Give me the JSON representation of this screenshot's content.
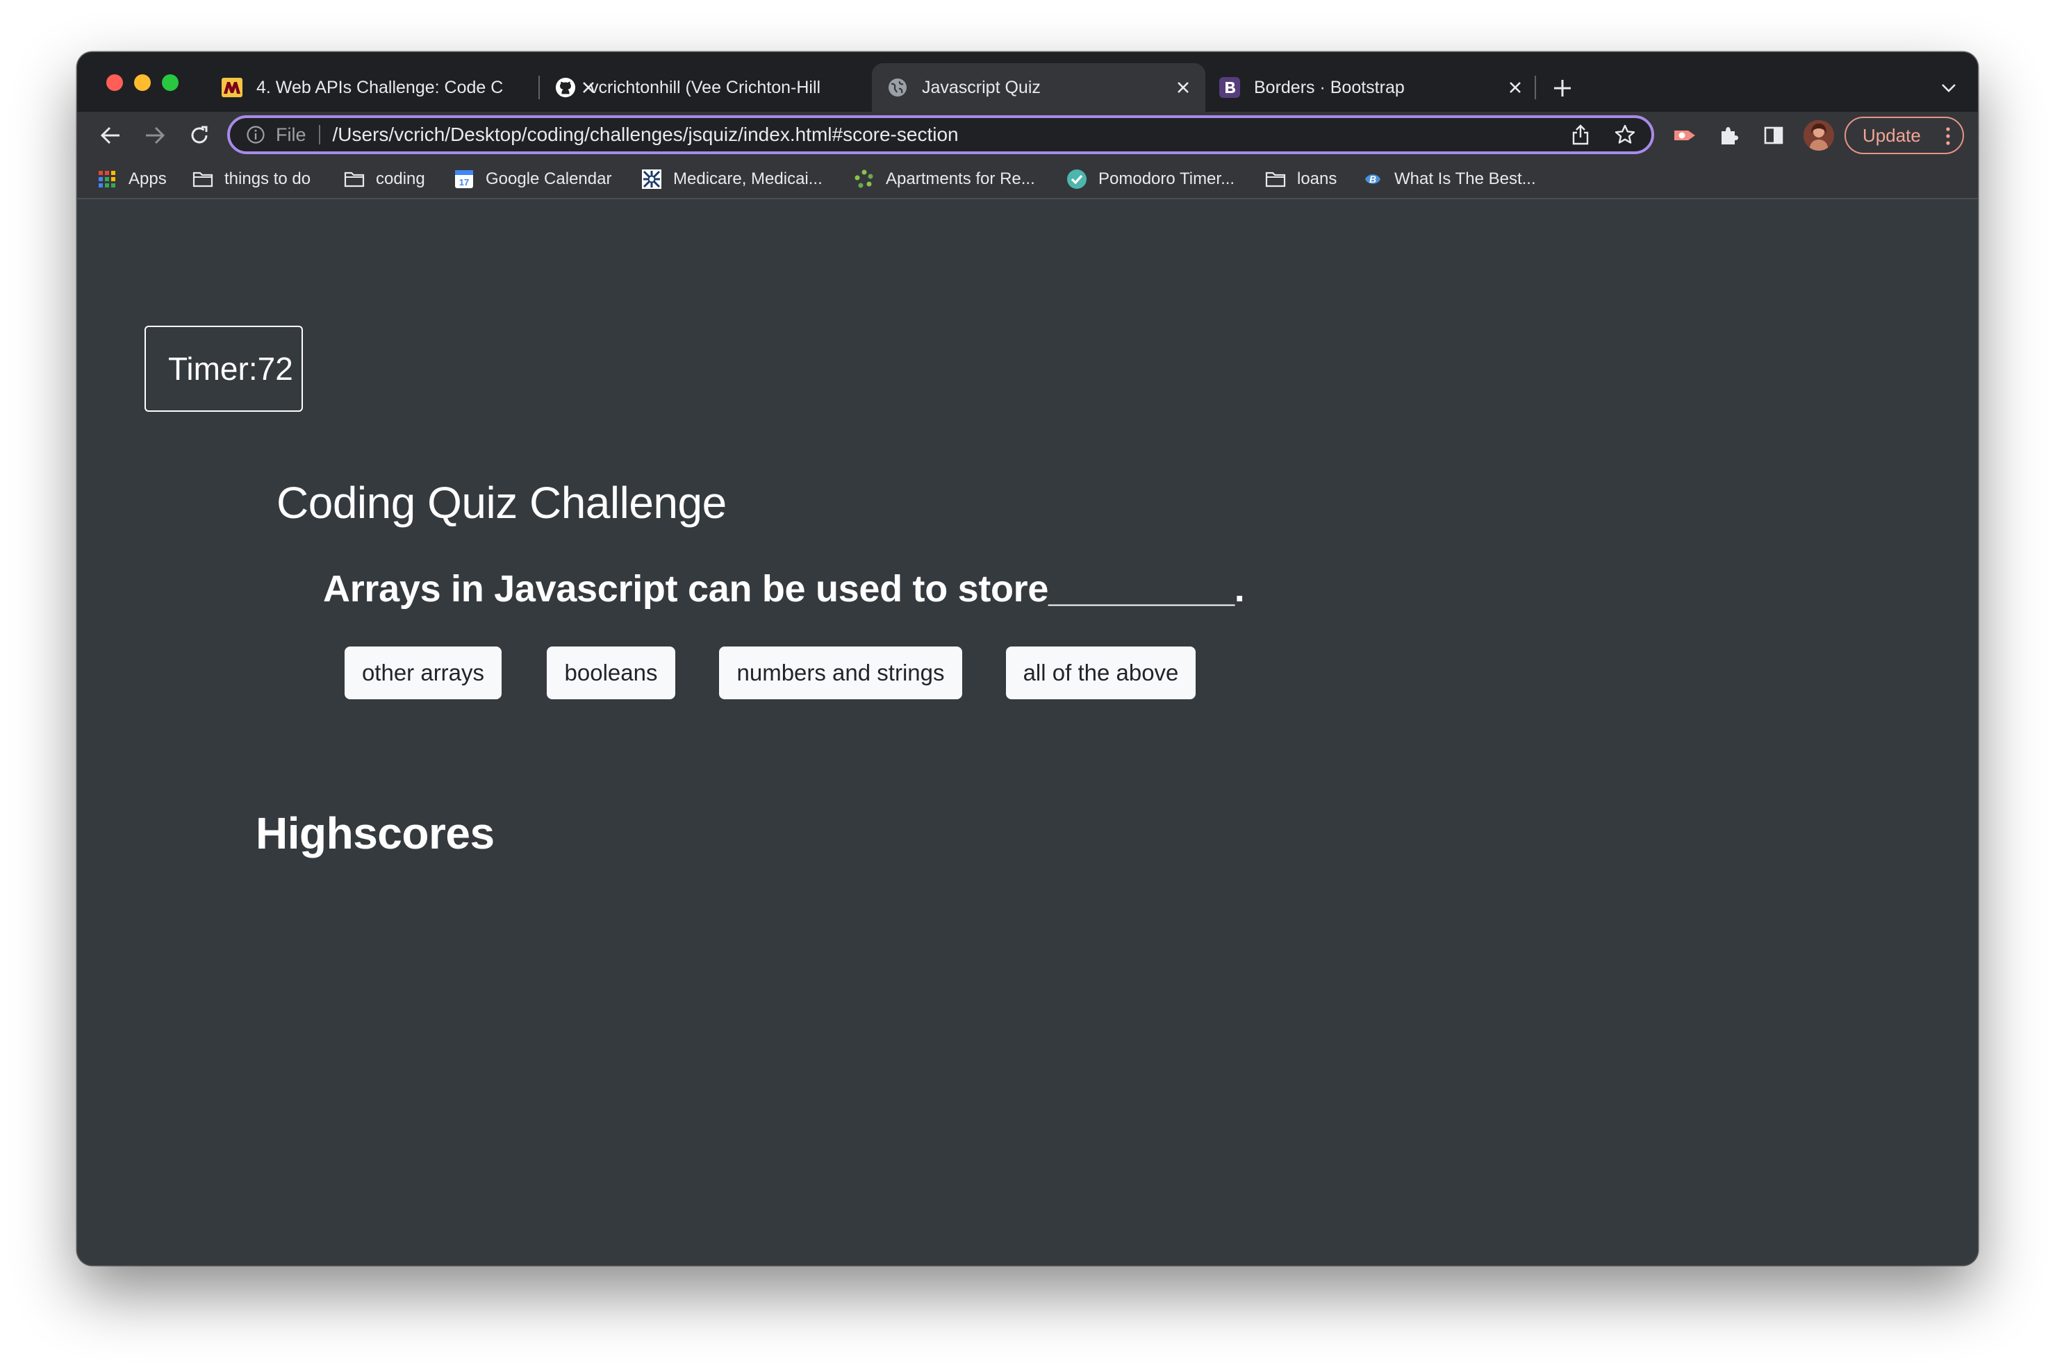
{
  "browser": {
    "tabs": [
      {
        "title": "4. Web APIs Challenge: Code C",
        "icon": "university-logo-icon",
        "active": false
      },
      {
        "title": "vcrichtonhill (Vee Crichton-Hill",
        "icon": "github-icon",
        "active": false
      },
      {
        "title": "Javascript Quiz",
        "icon": "globe-icon",
        "active": true
      },
      {
        "title": "Borders · Bootstrap",
        "icon": "bootstrap-icon",
        "active": false
      }
    ],
    "address": {
      "scheme_label": "File",
      "url": "/Users/vcrich/Desktop/coding/challenges/jsquiz/index.html#score-section"
    },
    "update_label": "Update",
    "bookmarks": [
      {
        "label": "Apps",
        "icon": "apps-grid-icon"
      },
      {
        "label": "things to do",
        "icon": "folder-icon"
      },
      {
        "label": "coding",
        "icon": "folder-icon"
      },
      {
        "label": "Google Calendar",
        "icon": "calendar-icon"
      },
      {
        "label": "Medicare, Medicai...",
        "icon": "medicare-icon"
      },
      {
        "label": "Apartments for Re...",
        "icon": "apartments-icon"
      },
      {
        "label": "Pomodoro Timer...",
        "icon": "check-circle-icon"
      },
      {
        "label": "loans",
        "icon": "folder-icon"
      },
      {
        "label": "What Is The Best...",
        "icon": "site-icon"
      }
    ],
    "colors": {
      "accent": "#a78bea",
      "update": "#f2a596",
      "page_bg": "#353a3f"
    }
  },
  "page": {
    "timer_label": "Timer:",
    "timer_value": "72",
    "title": "Coding Quiz Challenge",
    "question": "Arrays in Javascript can be used to store_________.",
    "answers": [
      "other arrays",
      "booleans",
      "numbers and strings",
      "all of the above"
    ],
    "highscores_title": "Highscores"
  }
}
